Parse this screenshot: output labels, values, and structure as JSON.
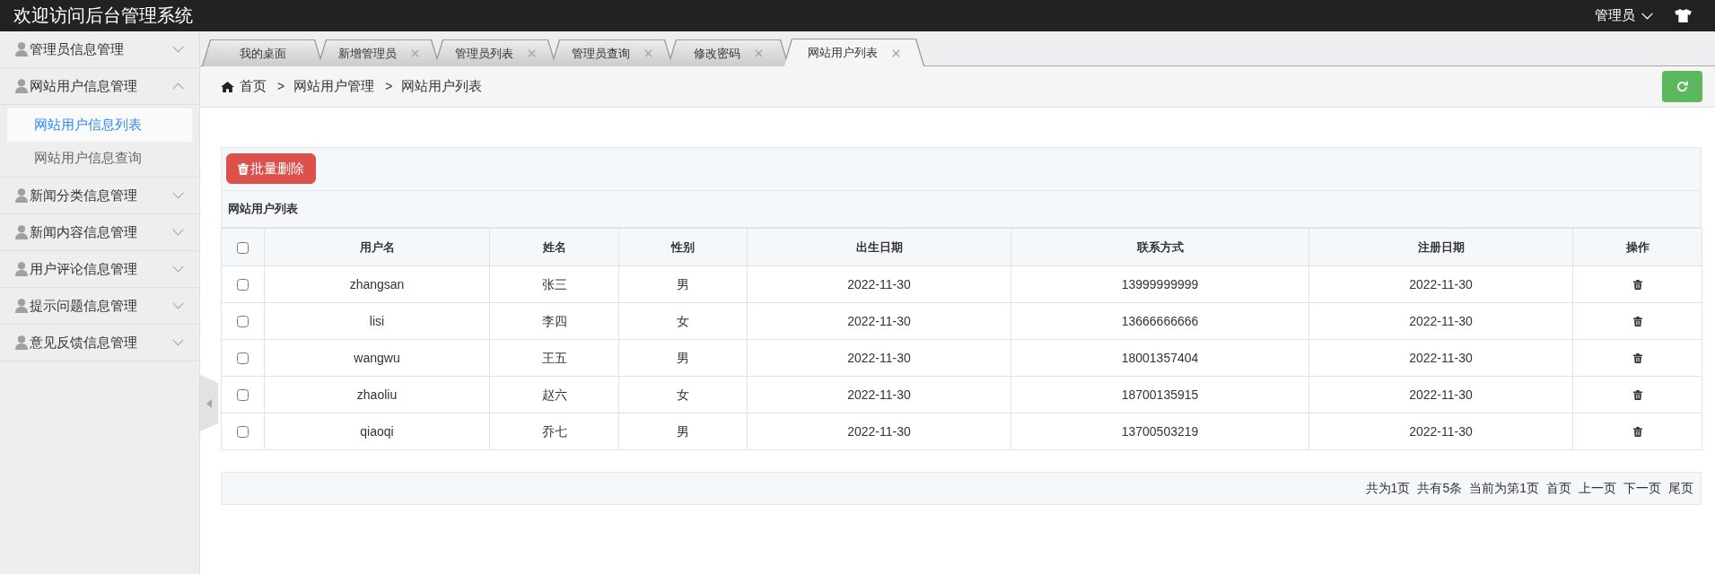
{
  "header": {
    "title": "欢迎访问后台管理系统",
    "user_menu": "管理员"
  },
  "sidebar": {
    "items": [
      {
        "label": "管理员信息管理",
        "expanded": false
      },
      {
        "label": "网站用户信息管理",
        "expanded": true,
        "children": [
          {
            "label": "网站用户信息列表",
            "selected": true
          },
          {
            "label": "网站用户信息查询",
            "selected": false
          }
        ]
      },
      {
        "label": "新闻分类信息管理",
        "expanded": false
      },
      {
        "label": "新闻内容信息管理",
        "expanded": false
      },
      {
        "label": "用户评论信息管理",
        "expanded": false
      },
      {
        "label": "提示问题信息管理",
        "expanded": false
      },
      {
        "label": "意见反馈信息管理",
        "expanded": false
      }
    ]
  },
  "tabs": [
    {
      "label": "我的桌面",
      "selected": false,
      "closable": false
    },
    {
      "label": "新增管理员",
      "selected": false,
      "closable": true
    },
    {
      "label": "管理员列表",
      "selected": false,
      "closable": true
    },
    {
      "label": "管理员查询",
      "selected": false,
      "closable": true
    },
    {
      "label": "修改密码",
      "selected": false,
      "closable": true
    },
    {
      "label": "网站用户列表",
      "selected": true,
      "closable": true
    }
  ],
  "breadcrumb": [
    {
      "kind": "home",
      "label": "首页"
    },
    {
      "kind": "link",
      "separator": ">",
      "label": "网站用户管理"
    },
    {
      "kind": "current",
      "separator": ">",
      "label": "网站用户列表"
    }
  ],
  "toolbar": {
    "batch_delete": "批量删除"
  },
  "table": {
    "title": "网站用户列表",
    "all_checked": false,
    "columns": [
      "用户名",
      "姓名",
      "性别",
      "出生日期",
      "联系方式",
      "注册日期",
      "操作"
    ],
    "rows": [
      {
        "checked": false,
        "cells": [
          "zhangsan",
          "张三",
          "男",
          "2022-11-30",
          "13999999999",
          "2022-11-30"
        ]
      },
      {
        "checked": false,
        "cells": [
          "lisi",
          "李四",
          "女",
          "2022-11-30",
          "13666666666",
          "2022-11-30"
        ]
      },
      {
        "checked": false,
        "cells": [
          "wangwu",
          "王五",
          "男",
          "2022-11-30",
          "18001357404",
          "2022-11-30"
        ]
      },
      {
        "checked": false,
        "cells": [
          "zhaoliu",
          "赵六",
          "女",
          "2022-11-30",
          "18700135915",
          "2022-11-30"
        ]
      },
      {
        "checked": false,
        "cells": [
          "qiaoqi",
          "乔七",
          "男",
          "2022-11-30",
          "13700503219",
          "2022-11-30"
        ]
      }
    ]
  },
  "pagination": {
    "info": [
      "共为1页",
      "共有5条",
      "当前为第1页"
    ],
    "links": [
      "首页",
      "上一页",
      "下一页",
      "尾页"
    ]
  }
}
